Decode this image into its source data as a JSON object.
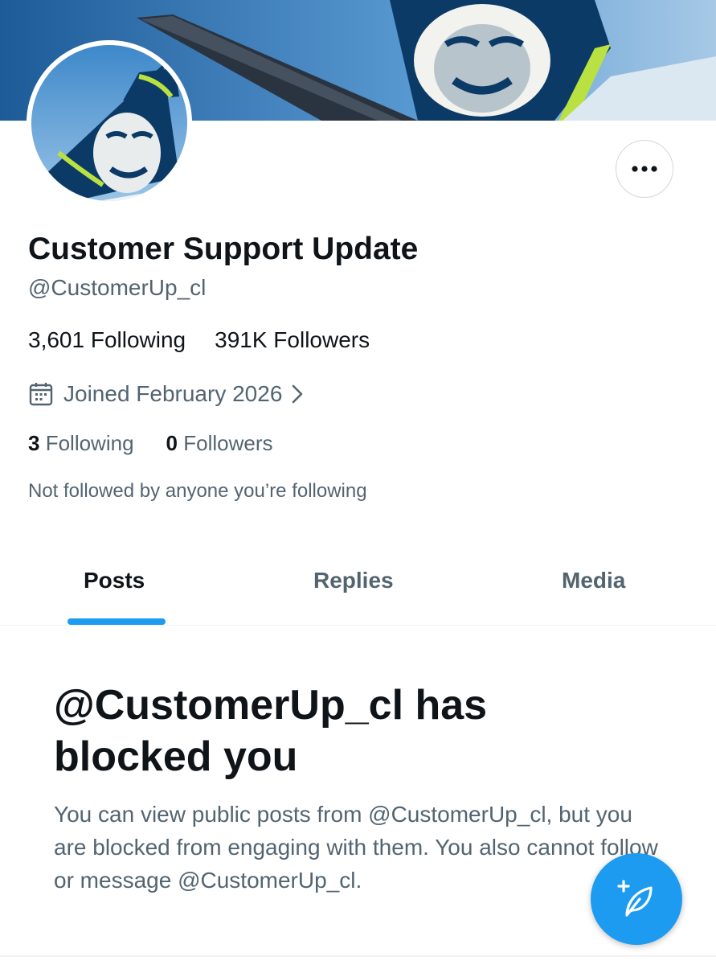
{
  "profile": {
    "display_name": "Customer Support Update",
    "handle": "@CustomerUp_cl",
    "stats_line": {
      "following": "3,601 Following",
      "followers": "391K Followers"
    },
    "joined": "Joined February 2026",
    "following_count": "3",
    "following_label": "Following",
    "followers_count": "0",
    "followers_label": "Followers",
    "not_followed_text": "Not followed by anyone you’re following"
  },
  "tabs": [
    {
      "label": "Posts",
      "active": true
    },
    {
      "label": "Replies",
      "active": false
    },
    {
      "label": "Media",
      "active": false
    }
  ],
  "blocked": {
    "title": "@CustomerUp_cl has blocked you",
    "body": "You can view public posts from @CustomerUp_cl, but you are blocked from engaging with them. You also cannot follow or message @CustomerUp_cl."
  },
  "icons": {
    "more": "more-horizontal-icon",
    "calendar": "calendar-icon",
    "chevron": "chevron-right-icon",
    "compose": "compose-post-icon"
  },
  "colors": {
    "accent": "#1d9bf0",
    "text_primary": "#0f1419",
    "text_secondary": "#536471",
    "banner_sky": "#3f7fb8",
    "tail_navy": "#0b3a66",
    "tail_stripe": "#b9e142"
  }
}
